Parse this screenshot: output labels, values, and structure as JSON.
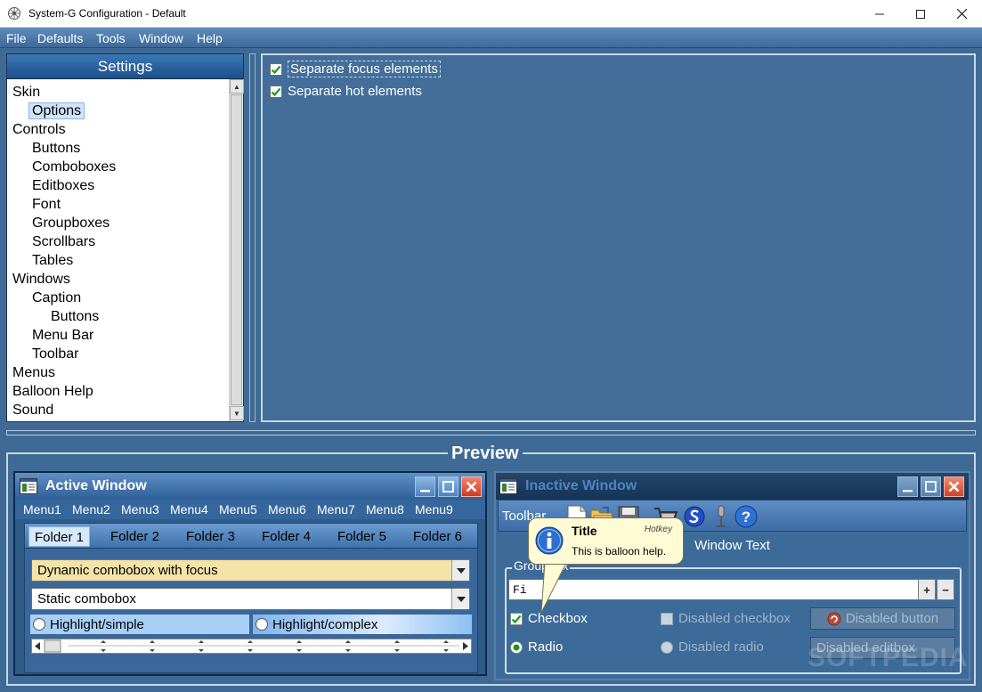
{
  "window": {
    "title": "System-G Configuration - Default"
  },
  "menubar": {
    "items": [
      "File",
      "Defaults",
      "Tools",
      "Window",
      "Help"
    ]
  },
  "settings": {
    "header": "Settings",
    "tree": [
      {
        "label": "Skin",
        "level": 0
      },
      {
        "label": "Options",
        "level": 1,
        "selected": true
      },
      {
        "label": "Controls",
        "level": 0
      },
      {
        "label": "Buttons",
        "level": 1
      },
      {
        "label": "Comboboxes",
        "level": 1
      },
      {
        "label": "Editboxes",
        "level": 1
      },
      {
        "label": "Font",
        "level": 1
      },
      {
        "label": "Groupboxes",
        "level": 1
      },
      {
        "label": "Scrollbars",
        "level": 1
      },
      {
        "label": "Tables",
        "level": 1
      },
      {
        "label": "Windows",
        "level": 0
      },
      {
        "label": "Caption",
        "level": 1
      },
      {
        "label": "Buttons",
        "level": 2
      },
      {
        "label": "Menu Bar",
        "level": 1
      },
      {
        "label": "Toolbar",
        "level": 1
      },
      {
        "label": "Menus",
        "level": 0
      },
      {
        "label": "Balloon Help",
        "level": 0
      },
      {
        "label": "Sound",
        "level": 0
      }
    ]
  },
  "options": {
    "separate_focus": {
      "label": "Separate focus elements",
      "checked": true
    },
    "separate_hot": {
      "label": "Separate hot elements",
      "checked": true
    }
  },
  "preview": {
    "title": "Preview",
    "active_window": {
      "title": "Active Window",
      "menus": [
        "Menu1",
        "Menu2",
        "Menu3",
        "Menu4",
        "Menu5",
        "Menu6",
        "Menu7",
        "Menu8",
        "Menu9"
      ],
      "tabs": [
        "Folder 1",
        "Folder 2",
        "Folder 3",
        "Folder 4",
        "Folder 5",
        "Folder 6"
      ],
      "dynamic_combo": "Dynamic combobox with focus",
      "static_combo": "Static combobox",
      "radio_simple": "Highlight/simple",
      "radio_complex": "Highlight/complex"
    },
    "inactive_window": {
      "title": "Inactive Window",
      "toolbar_label": "Toolbar",
      "window_text": "Window Text",
      "groupbox_title": "Groupbox",
      "editbox_value": "Fi",
      "checkbox": "Checkbox",
      "disabled_checkbox": "Disabled checkbox",
      "disabled_button": "Disabled button",
      "radio": "Radio",
      "disabled_radio": "Disabled radio",
      "disabled_editbox": "Disabled editbox"
    },
    "balloon": {
      "title": "Title",
      "hotkey": "Hotkey",
      "text": "This is balloon help."
    }
  },
  "watermark": "SOFTPEDIA",
  "colors": {
    "client_bg": "#3f6a95",
    "caption_active": "#2e5f96",
    "caption_inactive": "#163456",
    "selection": "#cfe4fa",
    "balloon_bg": "#fffbd5"
  }
}
